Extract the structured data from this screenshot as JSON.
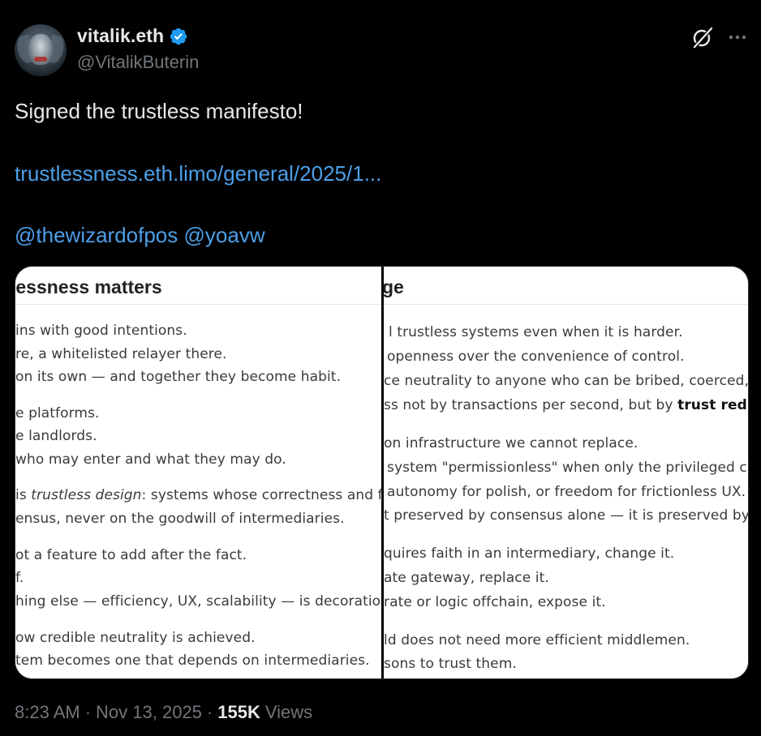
{
  "author": {
    "display_name": "vitalik.eth",
    "handle": "@VitalikButerin",
    "verified": true
  },
  "tweet": {
    "text": "Signed the trustless manifesto!",
    "link": "trustlessness.eth.limo/general/2025/1...",
    "mentions": [
      "@thewizardofpos",
      "@yoavw"
    ]
  },
  "media": {
    "left_heading": "lessness matters",
    "right_heading": "ge",
    "left_lines": [
      "ins with good intentions.",
      "re, a whitelisted relayer there.",
      "on its own — and together they become habit.",
      "e platforms.",
      "e landlords.",
      "who may enter and what they may do.",
      "is trustless design: systems whose correctness and fair",
      "ensus, never on the goodwill of intermediaries.",
      "ot a feature to add after the fact.",
      "f.",
      "hing else — efficiency, UX, scalability — is decoration o",
      "ow credible neutrality is achieved.",
      "tem becomes one that depends on intermediaries."
    ],
    "right_lines": [
      "l trustless systems even when it is harder.",
      "openness over the convenience of control.",
      "ce neutrality to anyone who can be bribed, coerced, o",
      "ss not by transactions per second, but by trust reduc",
      "on infrastructure we cannot replace.",
      "system \"permissionless\" when only the privileged ca",
      "autonomy for polish, or freedom for frictionless UX.",
      "t preserved by consensus alone — it is preserved by",
      "quires faith in an intermediary, change it.",
      "ate gateway, replace it.",
      "rate or logic offchain, expose it.",
      "ld does not need more efficient middlemen.",
      "sons to trust them."
    ]
  },
  "meta": {
    "time": "8:23 AM",
    "separator": "·",
    "date": "Nov 13, 2025",
    "separator2": "·",
    "views_count": "155K",
    "views_label": "Views"
  },
  "icons": {
    "verified": "verified-badge-icon",
    "grok": "grok-icon",
    "more": "more-options-icon"
  },
  "colors": {
    "background": "#000000",
    "text": "#e7e9ea",
    "secondary": "#71767b",
    "link": "#4c9fe8",
    "verified": "#1d9bf0"
  }
}
